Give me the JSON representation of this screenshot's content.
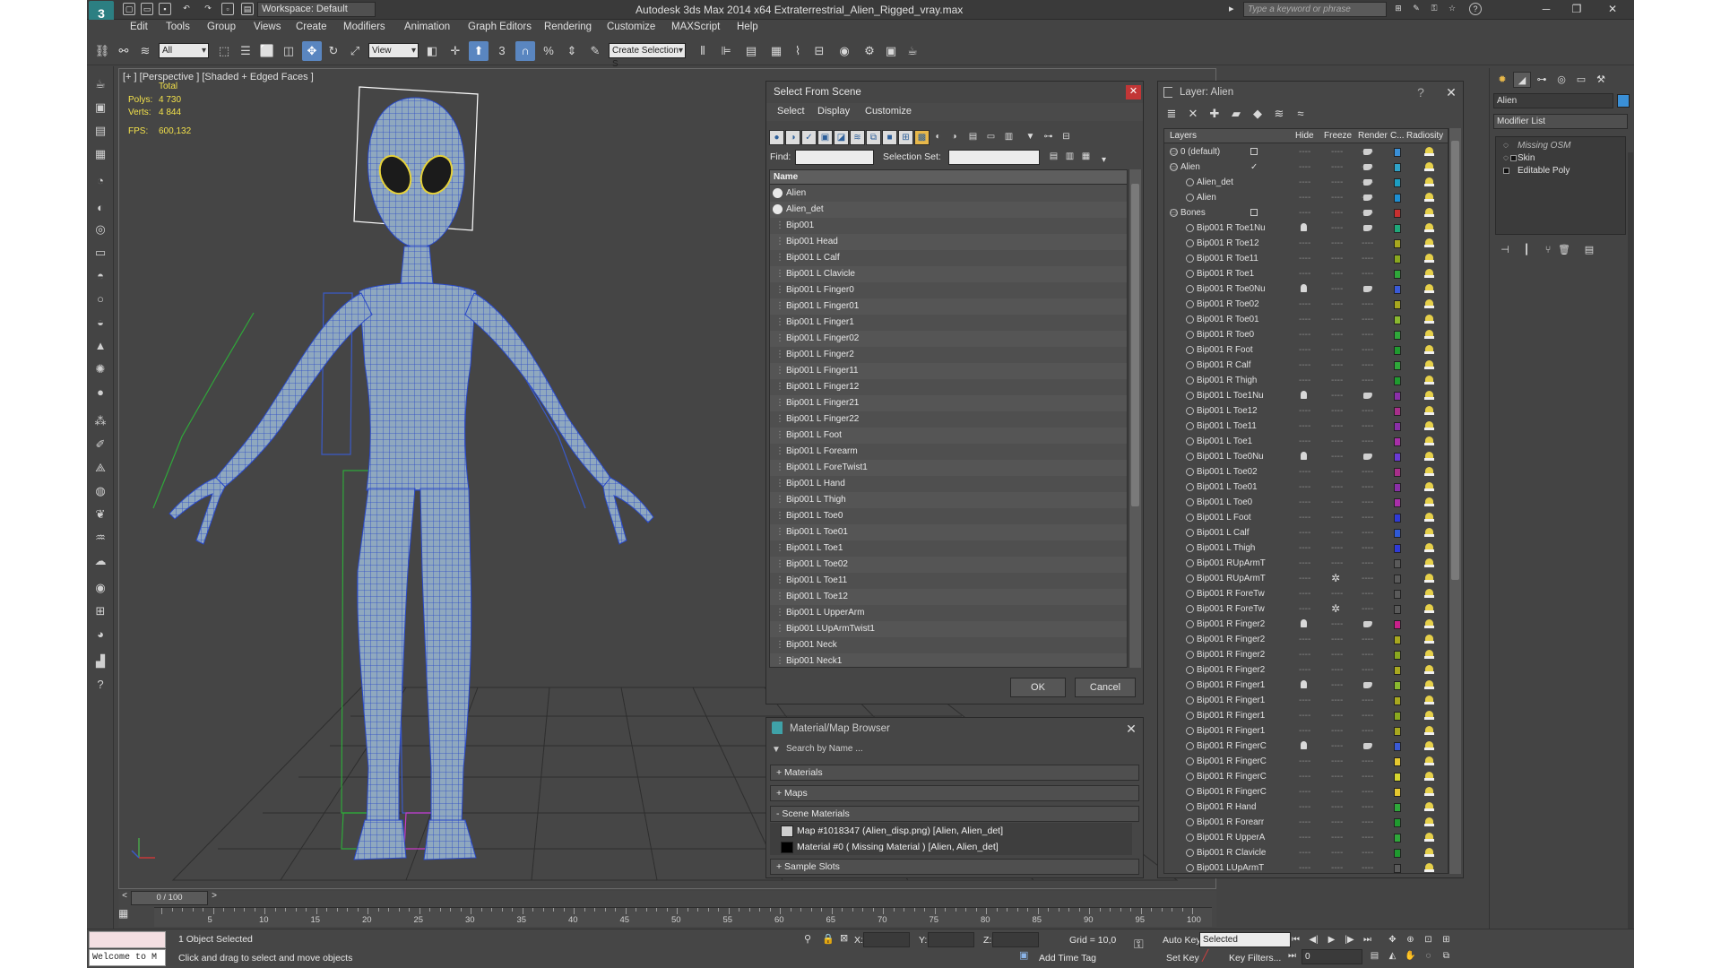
{
  "app": {
    "title": "Autodesk 3ds Max  2014 x64     Extraterrestrial_Alien_Rigged_vray.max",
    "workspace": "Workspace: Default",
    "search_placeholder": "Type a keyword or phrase"
  },
  "menu": [
    "Edit",
    "Tools",
    "Group",
    "Views",
    "Create",
    "Modifiers",
    "Animation",
    "Graph Editors",
    "Rendering",
    "Customize",
    "MAXScript",
    "Help"
  ],
  "toolbar": {
    "filter_value": "All",
    "ref_coord_value": "View",
    "selection_set_placeholder": "Create Selection S"
  },
  "viewport": {
    "label": "[+ ] [Perspective ] [Shaded + Edged Faces ]",
    "stats_total_label": "Total",
    "polys_label": "Polys:",
    "polys_value": "4 730",
    "verts_label": "Verts:",
    "verts_value": "4 844",
    "fps_label": "FPS:",
    "fps_value": "600,132"
  },
  "select_from_scene": {
    "title": "Select From Scene",
    "menus": [
      "Select",
      "Display",
      "Customize"
    ],
    "find_label": "Find:",
    "selection_set_label": "Selection Set:",
    "column_name": "Name",
    "items": [
      "Alien",
      "Alien_det",
      "Bip001",
      "Bip001 Head",
      "Bip001 L Calf",
      "Bip001 L Clavicle",
      "Bip001 L Finger0",
      "Bip001 L Finger01",
      "Bip001 L Finger1",
      "Bip001 L Finger02",
      "Bip001 L Finger2",
      "Bip001 L Finger11",
      "Bip001 L Finger12",
      "Bip001 L Finger21",
      "Bip001 L Finger22",
      "Bip001 L Foot",
      "Bip001 L Forearm",
      "Bip001 L ForeTwist1",
      "Bip001 L Hand",
      "Bip001 L Thigh",
      "Bip001 L Toe0",
      "Bip001 L Toe01",
      "Bip001 L Toe1",
      "Bip001 L Toe02",
      "Bip001 L Toe11",
      "Bip001 L Toe12",
      "Bip001 L UpperArm",
      "Bip001 LUpArmTwist1",
      "Bip001 Neck",
      "Bip001 Neck1"
    ],
    "ok_label": "OK",
    "cancel_label": "Cancel"
  },
  "material_browser": {
    "title": "Material/Map Browser",
    "search_placeholder": "Search by Name ...",
    "rollouts": {
      "materials": "+ Materials",
      "maps": "+ Maps",
      "scene": "- Scene Materials",
      "sample": "+ Sample Slots"
    },
    "scene_items": [
      {
        "label": "Map #1018347 (Alien_disp.png)  [Alien, Alien_det]",
        "swatch": "#cfcfcf"
      },
      {
        "label": "Material #0  ( Missing Material )  [Alien, Alien_det]",
        "swatch": "#000000"
      }
    ]
  },
  "layer_dialog": {
    "title": "Layer: Alien",
    "help": "?",
    "columns": {
      "layers": "Layers",
      "hide": "Hide",
      "freeze": "Freeze",
      "render": "Render",
      "color": "C...",
      "radiosity": "Radiosity"
    },
    "rows": [
      {
        "name": "0 (default)",
        "level": 0,
        "color": "#3a8fd6",
        "hide": false,
        "freeze_star": false,
        "check": "box"
      },
      {
        "name": "Alien",
        "level": 0,
        "color": "#2fa3c8",
        "hide": false,
        "freeze_star": false,
        "check": "tick"
      },
      {
        "name": "Alien_det",
        "level": 1,
        "color": "#1d9ec2",
        "hide": false,
        "freeze_star": false,
        "check": ""
      },
      {
        "name": "Alien",
        "level": 1,
        "color": "#1d8fd4",
        "hide": false,
        "freeze_star": false,
        "check": ""
      },
      {
        "name": "Bones",
        "level": 0,
        "color": "#c83030",
        "hide": false,
        "freeze_star": false,
        "check": "box"
      },
      {
        "name": "Bip001 R Toe1Nu",
        "level": 1,
        "color": "#1fa87a",
        "hide": true,
        "freeze_star": false,
        "check": ""
      },
      {
        "name": "Bip001 R Toe12",
        "level": 1,
        "color": "#a8a81f",
        "hide": false,
        "freeze_star": false,
        "check": ""
      },
      {
        "name": "Bip001 R Toe11",
        "level": 1,
        "color": "#8aa81f",
        "hide": false,
        "freeze_star": false,
        "check": ""
      },
      {
        "name": "Bip001 R Toe1",
        "level": 1,
        "color": "#2fa83a",
        "hide": false,
        "freeze_star": false,
        "check": ""
      },
      {
        "name": "Bip001 R Toe0Nu",
        "level": 1,
        "color": "#3a5ad6",
        "hide": true,
        "freeze_star": false,
        "check": ""
      },
      {
        "name": "Bip001 R Toe02",
        "level": 1,
        "color": "#a8a81f",
        "hide": false,
        "freeze_star": false,
        "check": ""
      },
      {
        "name": "Bip001 R Toe01",
        "level": 1,
        "color": "#8ab82f",
        "hide": false,
        "freeze_star": false,
        "check": ""
      },
      {
        "name": "Bip001 R Toe0",
        "level": 1,
        "color": "#2fa83a",
        "hide": false,
        "freeze_star": false,
        "check": ""
      },
      {
        "name": "Bip001 R Foot",
        "level": 1,
        "color": "#1f9a2f",
        "hide": false,
        "freeze_star": false,
        "check": ""
      },
      {
        "name": "Bip001 R Calf",
        "level": 1,
        "color": "#2fa83a",
        "hide": false,
        "freeze_star": false,
        "check": ""
      },
      {
        "name": "Bip001 R Thigh",
        "level": 1,
        "color": "#1f9a2f",
        "hide": false,
        "freeze_star": false,
        "check": ""
      },
      {
        "name": "Bip001 L Toe1Nu",
        "level": 1,
        "color": "#8a2fa8",
        "hide": true,
        "freeze_star": false,
        "check": ""
      },
      {
        "name": "Bip001 L Toe12",
        "level": 1,
        "color": "#a82f8a",
        "hide": false,
        "freeze_star": false,
        "check": ""
      },
      {
        "name": "Bip001 L Toe11",
        "level": 1,
        "color": "#8a2fa8",
        "hide": false,
        "freeze_star": false,
        "check": ""
      },
      {
        "name": "Bip001 L Toe1",
        "level": 1,
        "color": "#a82fa8",
        "hide": false,
        "freeze_star": false,
        "check": ""
      },
      {
        "name": "Bip001 L Toe0Nu",
        "level": 1,
        "color": "#6a3ad6",
        "hide": true,
        "freeze_star": false,
        "check": ""
      },
      {
        "name": "Bip001 L Toe02",
        "level": 1,
        "color": "#a82f8a",
        "hide": false,
        "freeze_star": false,
        "check": ""
      },
      {
        "name": "Bip001 L Toe01",
        "level": 1,
        "color": "#8a2fa8",
        "hide": false,
        "freeze_star": false,
        "check": ""
      },
      {
        "name": "Bip001 L Toe0",
        "level": 1,
        "color": "#a82fa8",
        "hide": false,
        "freeze_star": false,
        "check": ""
      },
      {
        "name": "Bip001 L Foot",
        "level": 1,
        "color": "#2f3ad6",
        "hide": false,
        "freeze_star": false,
        "check": ""
      },
      {
        "name": "Bip001 L Calf",
        "level": 1,
        "color": "#2f5ad6",
        "hide": false,
        "freeze_star": false,
        "check": ""
      },
      {
        "name": "Bip001 L Thigh",
        "level": 1,
        "color": "#2f3ad6",
        "hide": false,
        "freeze_star": false,
        "check": ""
      },
      {
        "name": "Bip001 RUpArmT",
        "level": 1,
        "color": "#5a5a5a",
        "hide": false,
        "freeze_star": false,
        "check": ""
      },
      {
        "name": "Bip001 RUpArmT",
        "level": 1,
        "color": "#5a5a5a",
        "hide": false,
        "freeze_star": true,
        "check": ""
      },
      {
        "name": "Bip001 R ForeTw",
        "level": 1,
        "color": "#5a5a5a",
        "hide": false,
        "freeze_star": false,
        "check": ""
      },
      {
        "name": "Bip001 R ForeTw",
        "level": 1,
        "color": "#5a5a5a",
        "hide": false,
        "freeze_star": true,
        "check": ""
      },
      {
        "name": "Bip001 R Finger2",
        "level": 1,
        "color": "#c8208a",
        "hide": true,
        "freeze_star": false,
        "check": ""
      },
      {
        "name": "Bip001 R Finger2",
        "level": 1,
        "color": "#a8a81f",
        "hide": false,
        "freeze_star": false,
        "check": ""
      },
      {
        "name": "Bip001 R Finger2",
        "level": 1,
        "color": "#8aa81f",
        "hide": false,
        "freeze_star": false,
        "check": ""
      },
      {
        "name": "Bip001 R Finger2",
        "level": 1,
        "color": "#a8a81f",
        "hide": false,
        "freeze_star": false,
        "check": ""
      },
      {
        "name": "Bip001 R Finger1",
        "level": 1,
        "color": "#8ab82f",
        "hide": true,
        "freeze_star": false,
        "check": ""
      },
      {
        "name": "Bip001 R Finger1",
        "level": 1,
        "color": "#a8a81f",
        "hide": false,
        "freeze_star": false,
        "check": ""
      },
      {
        "name": "Bip001 R Finger1",
        "level": 1,
        "color": "#8aa81f",
        "hide": false,
        "freeze_star": false,
        "check": ""
      },
      {
        "name": "Bip001 R Finger1",
        "level": 1,
        "color": "#a8a81f",
        "hide": false,
        "freeze_star": false,
        "check": ""
      },
      {
        "name": "Bip001 R FingerC",
        "level": 1,
        "color": "#3a5ad6",
        "hide": true,
        "freeze_star": false,
        "check": ""
      },
      {
        "name": "Bip001 R FingerC",
        "level": 1,
        "color": "#e6c82f",
        "hide": false,
        "freeze_star": false,
        "check": ""
      },
      {
        "name": "Bip001 R FingerC",
        "level": 1,
        "color": "#d6d62f",
        "hide": false,
        "freeze_star": false,
        "check": ""
      },
      {
        "name": "Bip001 R FingerC",
        "level": 1,
        "color": "#e6c82f",
        "hide": false,
        "freeze_star": false,
        "check": ""
      },
      {
        "name": "Bip001 R Hand",
        "level": 1,
        "color": "#2fa83a",
        "hide": false,
        "freeze_star": false,
        "check": ""
      },
      {
        "name": "Bip001 R Forearr",
        "level": 1,
        "color": "#1f9a2f",
        "hide": false,
        "freeze_star": false,
        "check": ""
      },
      {
        "name": "Bip001 R UpperA",
        "level": 1,
        "color": "#2fa83a",
        "hide": false,
        "freeze_star": false,
        "check": ""
      },
      {
        "name": "Bip001 R Clavicle",
        "level": 1,
        "color": "#1f9a2f",
        "hide": false,
        "freeze_star": false,
        "check": ""
      },
      {
        "name": "Bip001 LUpArmT",
        "level": 1,
        "color": "#5a5a5a",
        "hide": false,
        "freeze_star": false,
        "check": ""
      }
    ]
  },
  "command_panel": {
    "object_name": "Alien",
    "modifier_list": "Modifier List",
    "stack": [
      "Missing OSM",
      "Skin",
      "Editable Poly"
    ]
  },
  "timeline": {
    "frame_indicator": "0 / 100",
    "ticks": [
      "5",
      "10",
      "15",
      "20",
      "25",
      "30",
      "35",
      "40",
      "45",
      "50",
      "55",
      "60",
      "65",
      "70",
      "75",
      "80",
      "85",
      "90",
      "95",
      "100"
    ]
  },
  "status": {
    "maxscript": "Welcome to M",
    "selected": "1 Object Selected",
    "prompt": "Click and drag to select and move objects",
    "x_label": "X:",
    "y_label": "Y:",
    "z_label": "Z:",
    "grid": "Grid = 10,0",
    "auto_key": "Auto Key",
    "set_key": "Set Key",
    "key_mode": "Selected",
    "add_time_tag": "Add Time Tag",
    "key_filters": "Key Filters...",
    "frame_value": "0"
  },
  "colors": {
    "accent": "#5a86c0",
    "ui_bg": "#444444",
    "close_red": "#c23636",
    "stats_yellow": "#f2e04a"
  }
}
